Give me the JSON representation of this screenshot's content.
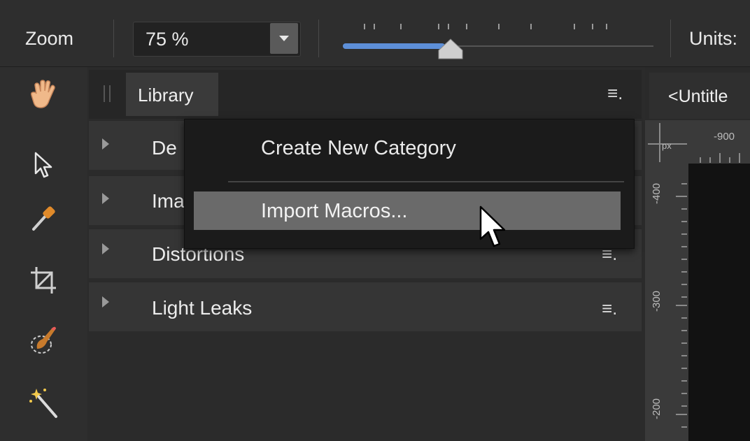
{
  "toolbar": {
    "zoom_label": "Zoom",
    "zoom_value": "75 %",
    "zoom_level_fraction": 0.33,
    "units_label": "Units:"
  },
  "tools": [
    {
      "name": "hand-tool",
      "icon": "hand-icon"
    },
    {
      "name": "move-tool",
      "icon": "pointer-arrow-icon"
    },
    {
      "name": "color-picker-tool",
      "icon": "eyedropper-icon"
    },
    {
      "name": "crop-tool",
      "icon": "crop-icon"
    },
    {
      "name": "selection-brush-tool",
      "icon": "brush-selection-icon"
    },
    {
      "name": "flood-select-tool",
      "icon": "magic-wand-icon"
    }
  ],
  "library": {
    "tab_label": "Library",
    "rows": [
      {
        "label": "De"
      },
      {
        "label": "Ima"
      },
      {
        "label": "Distortions"
      },
      {
        "label": "Light Leaks"
      }
    ]
  },
  "context_menu": {
    "items": [
      "Create New Category",
      "Import Macros..."
    ],
    "highlighted": "Import Macros..."
  },
  "document": {
    "tab_title": "<Untitle",
    "ruler_unit": "px",
    "h_ruler_label": "-900",
    "v_ruler_labels": [
      "-400",
      "-300",
      "-200"
    ]
  },
  "colors": {
    "accent": "#5d8fd8",
    "menu_highlight": "#6a6a6a",
    "panel_bg": "#2b2b2b"
  }
}
